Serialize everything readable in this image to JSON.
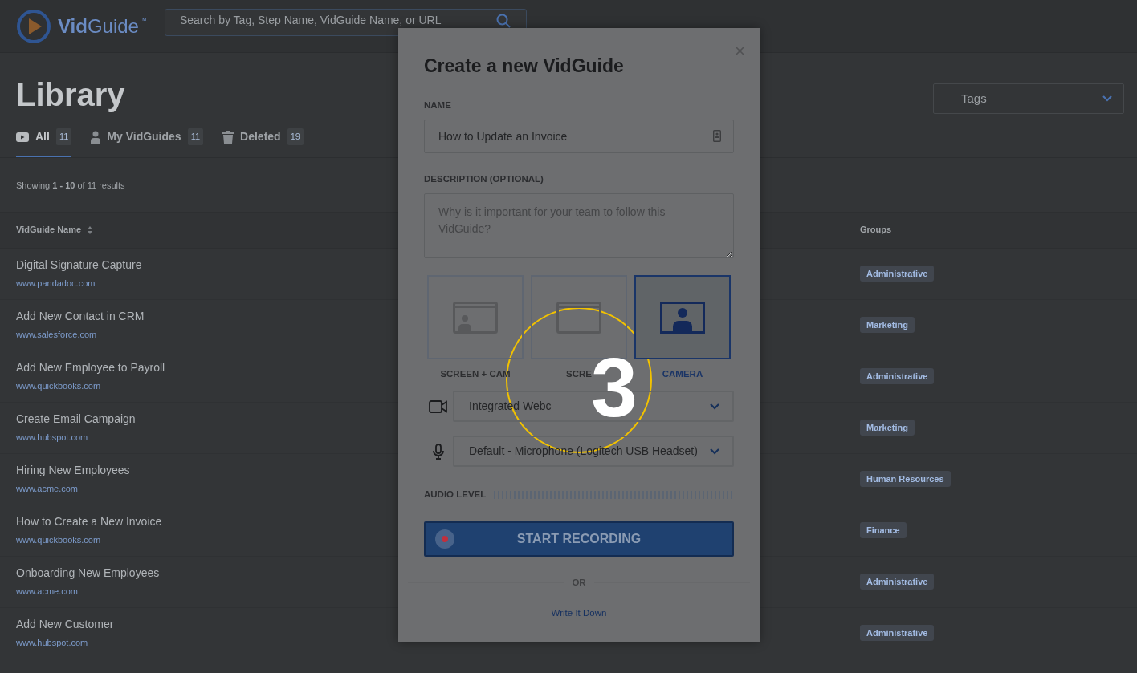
{
  "header": {
    "logo": "**Vid**Guide$^{™}$",
    "search": {
      "placeholder": "Search by Tag, Step Name, VidGuide Name, or URL"
    }
  },
  "page": {
    "title": "Library",
    "tags_filter": {
      "placeholder": "Tags"
    }
  },
  "tabs": [
    {
      "label": "All",
      "count": "11",
      "kind": "video",
      "selected": true
    },
    {
      "label": "My VidGuides",
      "count": "11",
      "kind": "person",
      "selected": false
    },
    {
      "label": "Deleted",
      "count": "19",
      "kind": "trash",
      "selected": false
    }
  ],
  "results_summary": "Showing **1 - 10** of 11 results",
  "table": {
    "columns": [
      "VidGuide Name",
      "Groups"
    ],
    "rows": [
      {
        "name": "Digital Signature Capture",
        "url": "www.pandadoc.com",
        "group": "Administrative"
      },
      {
        "name": "Add New Contact in CRM",
        "url": "www.salesforce.com",
        "group": "Marketing"
      },
      {
        "name": "Add New Employee to Payroll",
        "url": "www.quickbooks.com",
        "group": "Administrative"
      },
      {
        "name": "Create Email Campaign",
        "url": "www.hubspot.com",
        "group": "Marketing"
      },
      {
        "name": "Hiring New Employees",
        "url": "www.acme.com",
        "group": "Human Resources"
      },
      {
        "name": "How to Create a New Invoice",
        "url": "www.quickbooks.com",
        "group": "Finance"
      },
      {
        "name": "Onboarding New Employees",
        "url": "www.acme.com",
        "group": "Administrative"
      },
      {
        "name": "Add New Customer",
        "url": "www.hubspot.com",
        "group": "Administrative"
      }
    ]
  },
  "modal": {
    "title": "Create a new VidGuide",
    "name_label": "NAME",
    "name_value": "How to Update an Invoice",
    "description_label": "DESCRIPTION (OPTIONAL)",
    "description_placeholder": "Why is it important for your team to follow this VidGuide?",
    "modes": [
      {
        "label": "SCREEN + CAM",
        "kind": "screen_cam",
        "selected": false
      },
      {
        "label": "SCRE",
        "kind": "screen",
        "selected": false
      },
      {
        "label": "CAMERA",
        "kind": "camera",
        "selected": true
      }
    ],
    "devices": [
      {
        "kind": "camera",
        "value": "Integrated Webc"
      },
      {
        "kind": "microphone",
        "value": "Default - Microphone (Logitech USB Headset)"
      }
    ],
    "audio_label": "AUDIO LEVEL",
    "record_button": "START RECORDING",
    "divider": "OR",
    "alt_link": "Write It Down"
  },
  "annotation": {
    "text": "3"
  }
}
